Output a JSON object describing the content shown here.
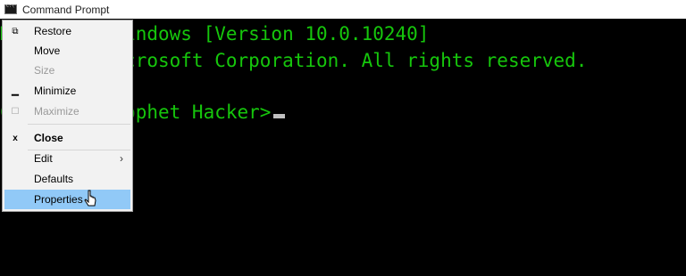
{
  "window": {
    "title": "Command Prompt"
  },
  "console": {
    "lines": [
      "Microsoft Windows [Version 10.0.10240]",
      "(c) 2015 Microsoft Corporation. All rights reserved.",
      "C:\\Users\\Prophet Hacker>"
    ]
  },
  "menu": {
    "restore": {
      "label": "Restore",
      "icon": "restore-icon"
    },
    "move": {
      "label": "Move"
    },
    "size": {
      "label": "Size"
    },
    "minimize": {
      "label": "Minimize",
      "icon": "minimize-icon"
    },
    "maximize": {
      "label": "Maximize",
      "icon": "maximize-icon"
    },
    "close": {
      "label": "Close",
      "icon": "close-icon"
    },
    "edit": {
      "label": "Edit",
      "arrow": "›"
    },
    "defaults": {
      "label": "Defaults"
    },
    "properties": {
      "label": "Properties"
    }
  },
  "colors": {
    "console_text": "#16c60c",
    "menu_highlight": "#91c9f7"
  }
}
